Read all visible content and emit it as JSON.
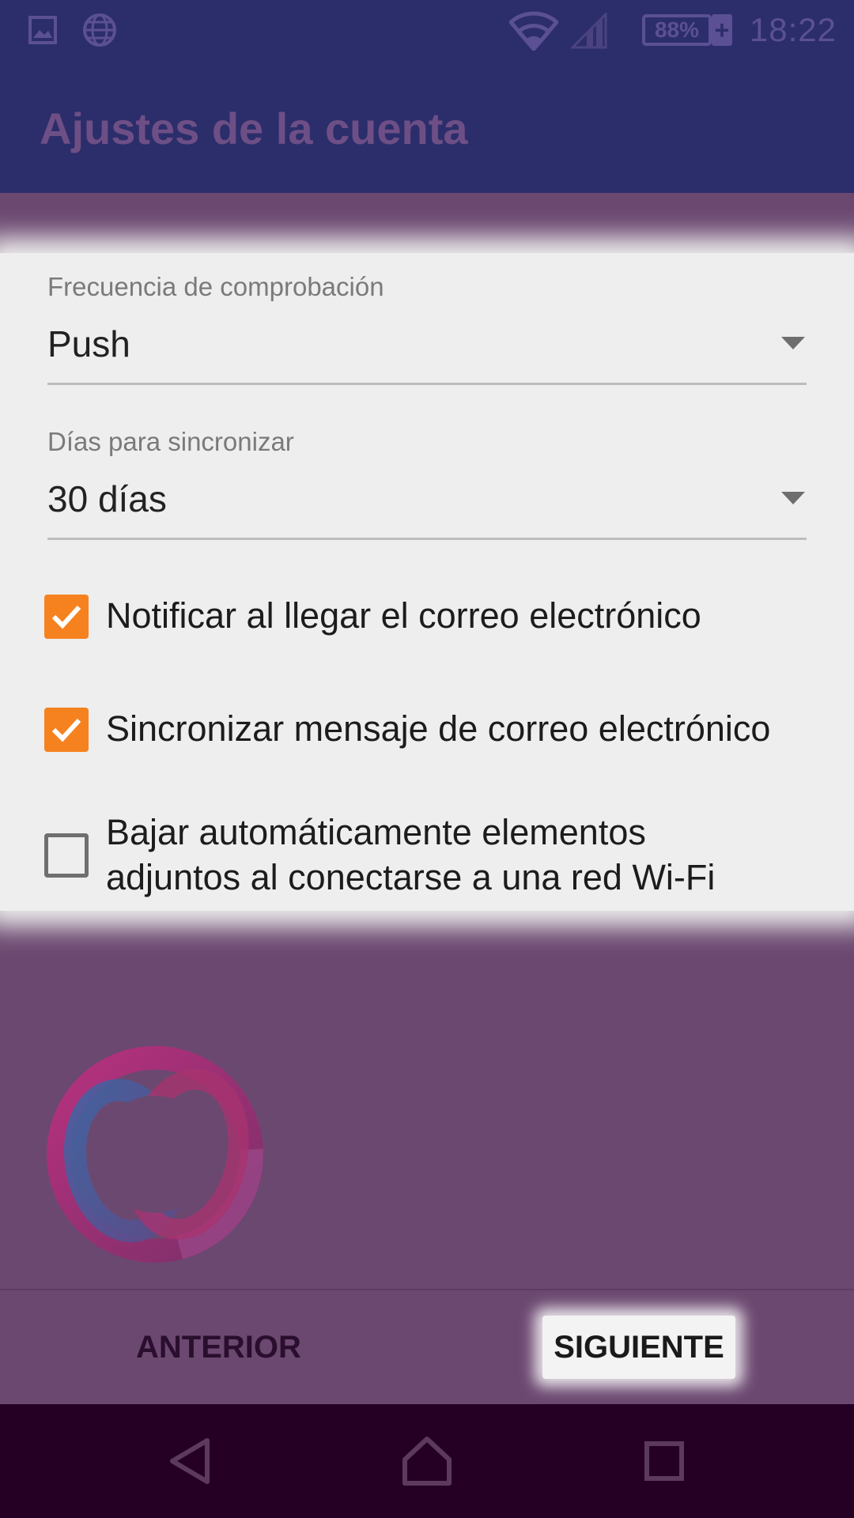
{
  "status_bar": {
    "battery": "88%",
    "battery_charging": "+",
    "time": "18:22",
    "icons": [
      "image-icon",
      "globe-icon",
      "wifi-icon",
      "signal-icon",
      "battery-icon"
    ]
  },
  "app_bar": {
    "title": "Ajustes de la cuenta"
  },
  "settings": {
    "check_frequency": {
      "label": "Frecuencia de comprobación",
      "value": "Push"
    },
    "sync_days": {
      "label": "Días para sincronizar",
      "value": "30 días"
    },
    "notify": {
      "label": "Notificar al llegar el correo electrónico",
      "checked": true
    },
    "sync_mail": {
      "label": "Sincronizar mensaje de correo electrónico",
      "checked": true
    },
    "auto_download": {
      "label_line1": "Bajar automáticamente elementos",
      "label_line2": "adjuntos al conectarse a una red Wi-Fi",
      "checked": false
    }
  },
  "buttons": {
    "previous": "ANTERIOR",
    "next": "SIGUIENTE"
  },
  "colors": {
    "accent": "#f5821f",
    "app_bar": "#2c2e6b",
    "background": "#6b4870",
    "nav_bar": "#250024"
  }
}
